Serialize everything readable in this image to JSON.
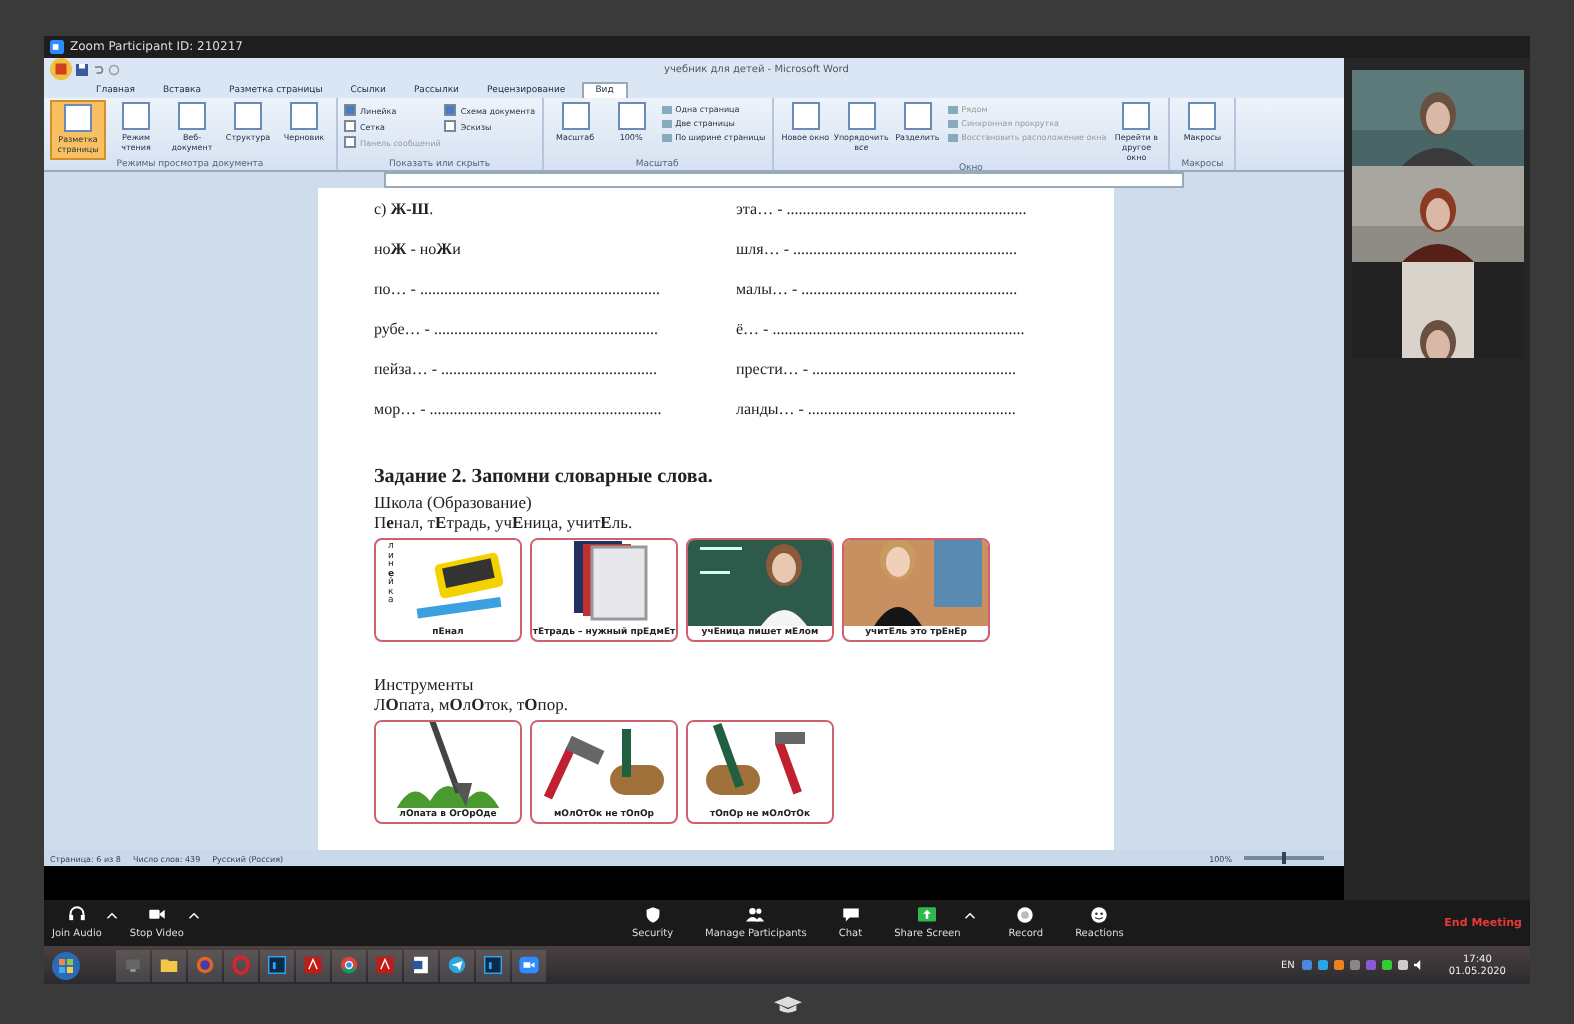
{
  "zoom_window": {
    "title": "Zoom Participant ID: 210217"
  },
  "word": {
    "title": "учебник для детей - Microsoft Word",
    "tabs": [
      {
        "label": "Главная",
        "selected": false
      },
      {
        "label": "Вставка",
        "selected": false
      },
      {
        "label": "Разметка страницы",
        "selected": false
      },
      {
        "label": "Ссылки",
        "selected": false
      },
      {
        "label": "Рассылки",
        "selected": false
      },
      {
        "label": "Рецензирование",
        "selected": false
      },
      {
        "label": "Вид",
        "selected": true
      }
    ],
    "ribbon_groups": [
      {
        "label": "Режимы просмотра документа",
        "items": [
          {
            "kind": "large",
            "label": "Разметка страницы",
            "selected": true
          },
          {
            "kind": "large",
            "label": "Режим чтения",
            "selected": false
          },
          {
            "kind": "large",
            "label": "Веб-документ",
            "selected": false
          },
          {
            "kind": "large",
            "label": "Структура",
            "selected": false
          },
          {
            "kind": "large",
            "label": "Черновик",
            "selected": false
          }
        ]
      },
      {
        "label": "Показать или скрыть",
        "items": [
          {
            "kind": "check",
            "label": "Линейка",
            "checked": true,
            "disabled": false
          },
          {
            "kind": "check",
            "label": "Сетка",
            "checked": false,
            "disabled": false
          },
          {
            "kind": "check",
            "label": "Панель сообщений",
            "checked": false,
            "disabled": true
          },
          {
            "kind": "check",
            "label": "Схема документа",
            "checked": true,
            "disabled": false
          },
          {
            "kind": "check",
            "label": "Эскизы",
            "checked": false,
            "disabled": false
          }
        ]
      },
      {
        "label": "Масштаб",
        "items": [
          {
            "kind": "large",
            "label": "Масштаб",
            "selected": false
          },
          {
            "kind": "large",
            "label": "100%",
            "selected": false
          },
          {
            "kind": "small",
            "label": "Одна страница",
            "disabled": false
          },
          {
            "kind": "small",
            "label": "Две страницы",
            "disabled": false
          },
          {
            "kind": "small",
            "label": "По ширине страницы",
            "disabled": false
          }
        ]
      },
      {
        "label": "Окно",
        "items": [
          {
            "kind": "large",
            "label": "Новое окно",
            "selected": false
          },
          {
            "kind": "large",
            "label": "Упорядочить все",
            "selected": false
          },
          {
            "kind": "large",
            "label": "Разделить",
            "selected": false
          },
          {
            "kind": "small",
            "label": "Рядом",
            "disabled": true
          },
          {
            "kind": "small",
            "label": "Синхронная прокрутка",
            "disabled": true
          },
          {
            "kind": "small",
            "label": "Восстановить расположение окна",
            "disabled": true
          },
          {
            "kind": "large",
            "label": "Перейти в другое окно",
            "selected": false
          }
        ]
      },
      {
        "label": "Макросы",
        "items": [
          {
            "kind": "large",
            "label": "Макросы",
            "selected": false
          }
        ]
      }
    ],
    "document": {
      "rows": [
        {
          "left": "с) **Ж-Ш**.",
          "right": "эта… - ............................................................"
        },
        {
          "left": "но**Ж** - но**Ж**и",
          "right": "шля… - ........................................................"
        },
        {
          "left": "по… - ............................................................",
          "right": "малы… - ......................................................"
        },
        {
          "left": "рубе… - ........................................................",
          "right": "ё… - ..............................................................."
        },
        {
          "left": "пейза… - ......................................................",
          "right": "прести… - ..................................................."
        },
        {
          "left": "мор… - ..........................................................",
          "right": "ланды… - ...................................................."
        }
      ],
      "task_title": "Задание 2. Запомни словарные слова.",
      "sections": [
        {
          "heading": "Школа (Образование)",
          "words": "П**е**нал, т**Е**традь, уч**Е**ница, учит**Е**ль.",
          "cards": [
            {
              "caption": "п**Е**нал",
              "vertical": "лин**е**йка"
            },
            {
              "caption": "т**Е**традь – нужный пр**Е**дм**Е**т"
            },
            {
              "caption": "уч**Е**ница пишет м**Е**лом"
            },
            {
              "caption": "учит**Е**ль это тр**Е**н**Е**р"
            }
          ]
        },
        {
          "heading": "Инструменты",
          "words": "Л**О**пата, м**О**л**О**ток, т**О**пор.",
          "cards": [
            {
              "caption": "л**О**пата в **О**г**О**р**О**де"
            },
            {
              "caption": "м**О**л**О**т**О**к не т**О**п**О**р"
            },
            {
              "caption": "т**О**п**О**р не м**О**л**О**т**О**к"
            }
          ]
        }
      ]
    },
    "status_bar": [
      "Страница: 6 из 8",
      "Число слов: 439",
      "Русский (Россия)"
    ],
    "zoom_level": "100%",
    "zoom_slider": {
      "level": 0.5
    }
  },
  "toolbar": {
    "left": [
      {
        "label": "Join Audio",
        "caret": true
      },
      {
        "label": "Stop Video",
        "caret": true
      }
    ],
    "center": [
      {
        "label": "Security",
        "caret": false
      },
      {
        "label": "Manage Participants",
        "caret": false
      },
      {
        "label": "Chat",
        "caret": false
      },
      {
        "label": "Share Screen",
        "caret": true
      },
      {
        "label": "Record",
        "caret": false
      },
      {
        "label": "Reactions",
        "caret": false
      }
    ],
    "end": "End Meeting"
  },
  "taskbar": {
    "language": "EN",
    "time": "17:40",
    "date": "01.05.2020"
  }
}
